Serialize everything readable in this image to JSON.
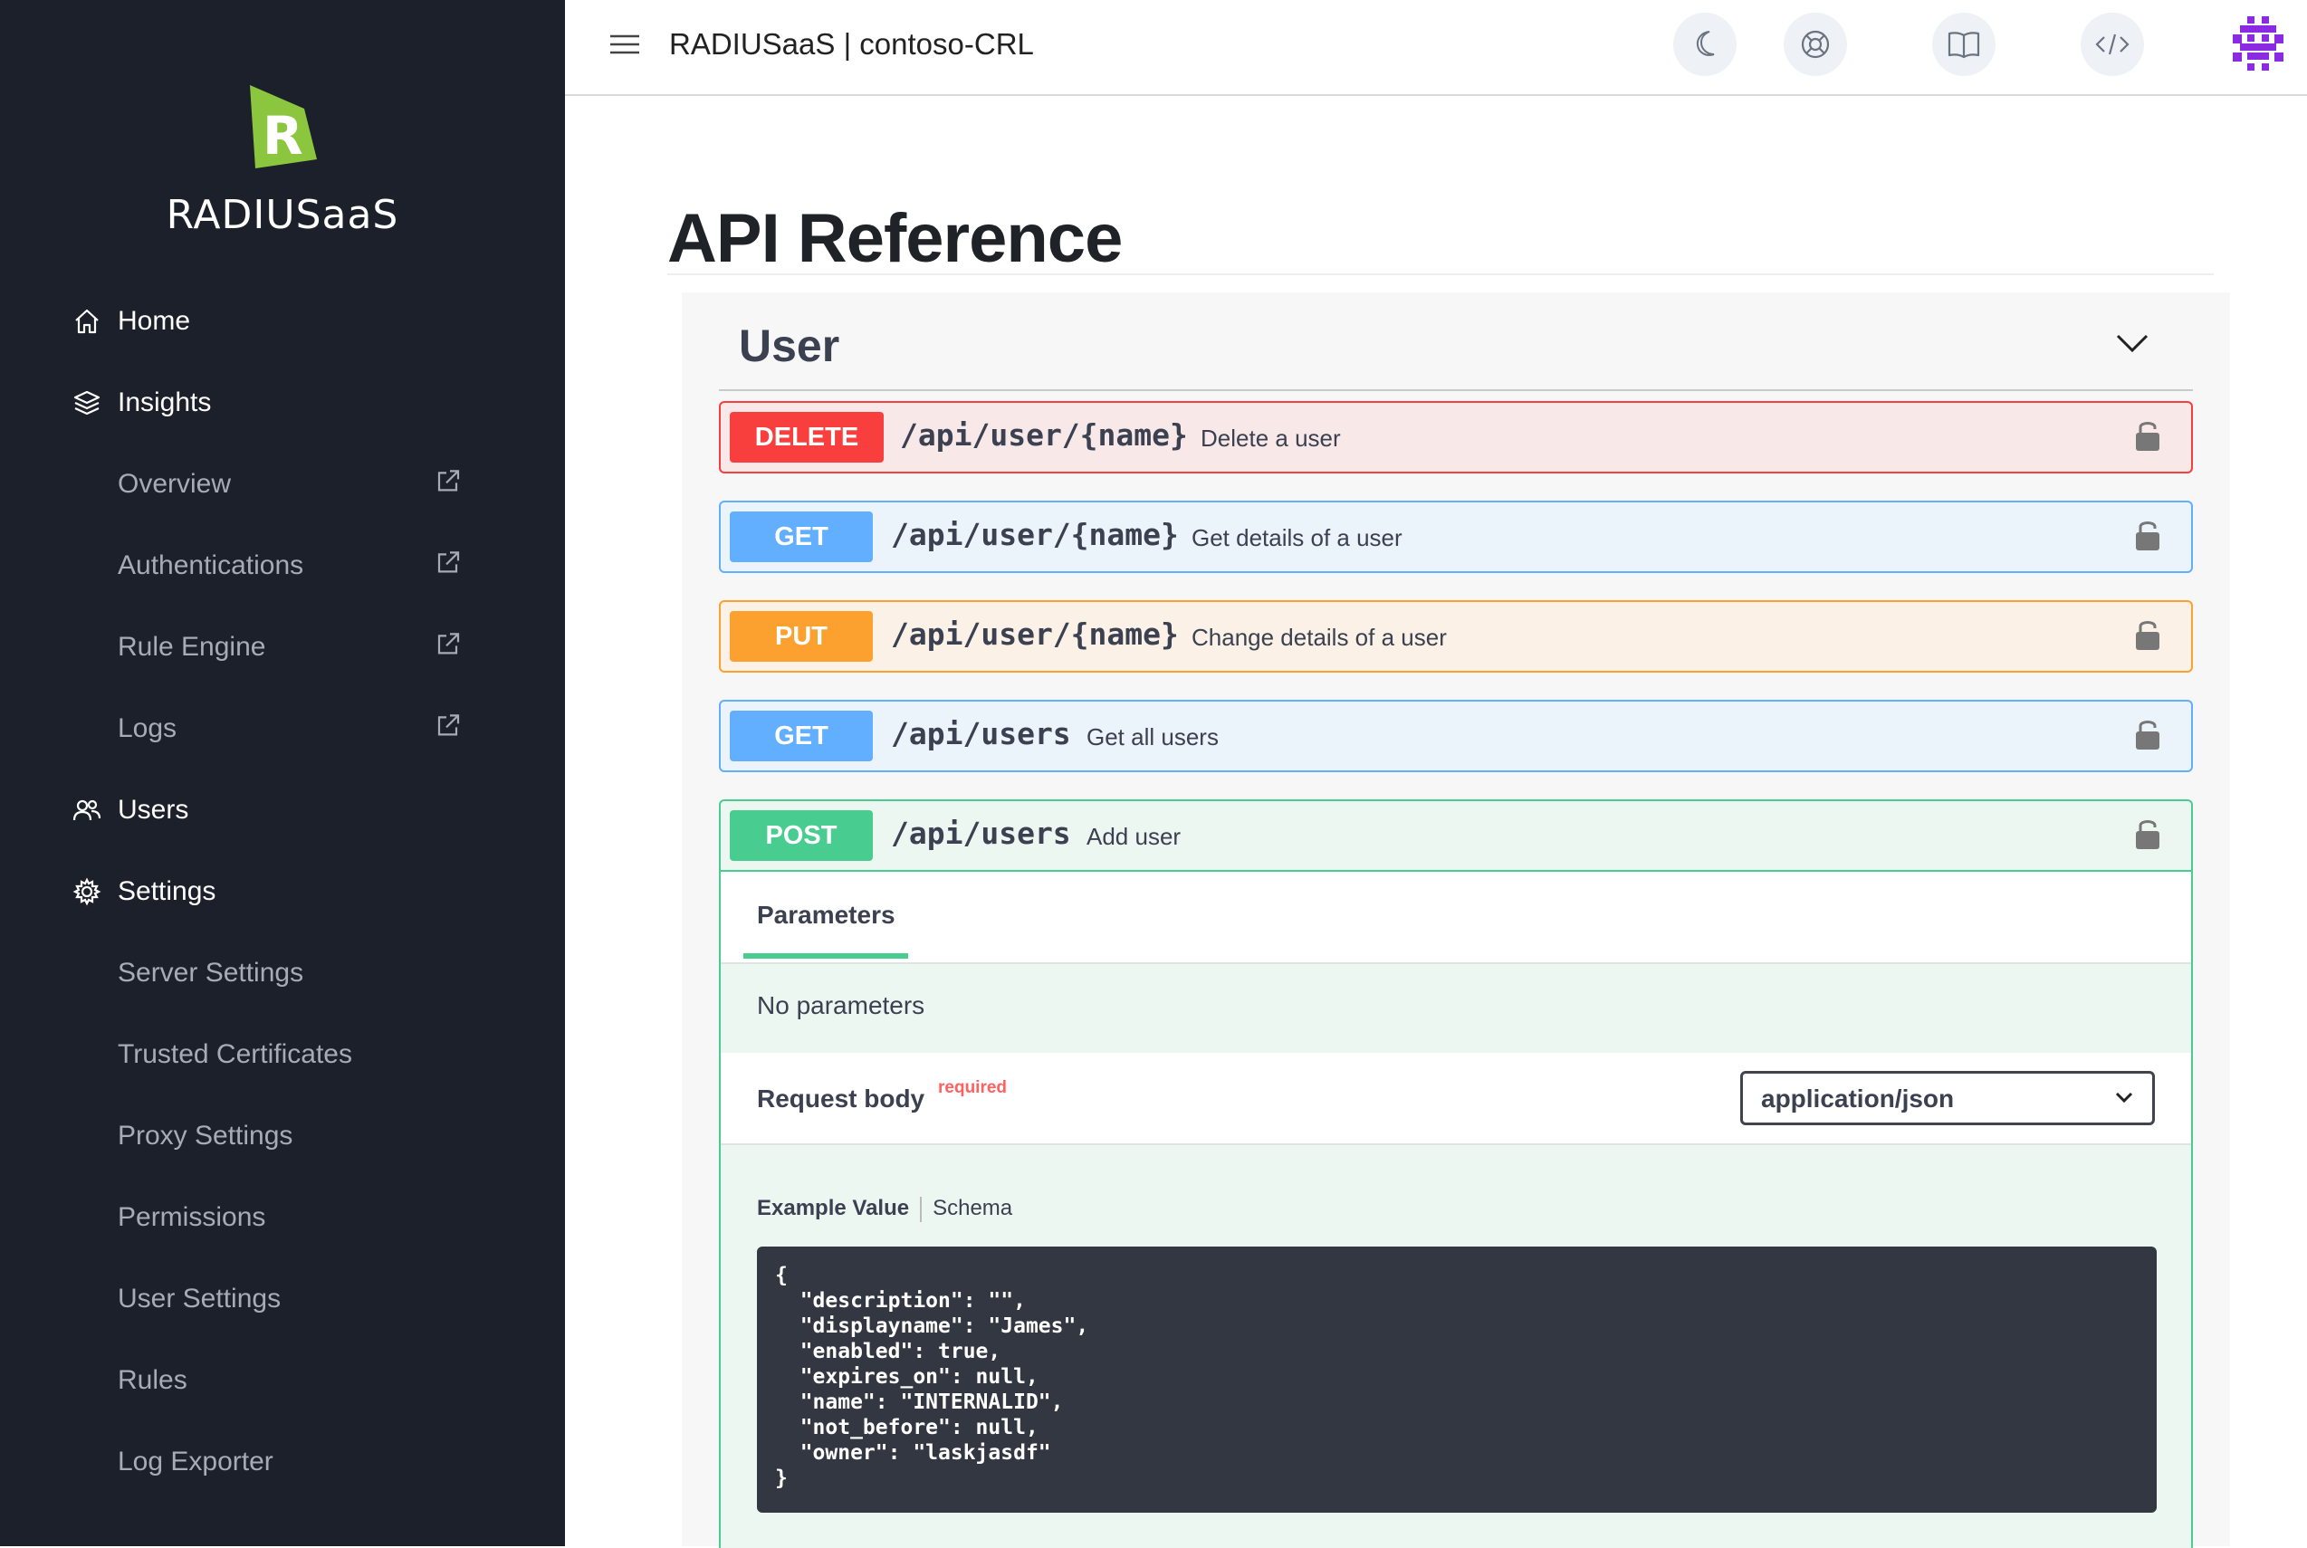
{
  "sidebar": {
    "brand_name": "RADIUSaaS",
    "logo_letter": "R",
    "items": [
      {
        "label": "Home",
        "icon": "home-icon",
        "level": "top",
        "external": false
      },
      {
        "label": "Insights",
        "icon": "layers-icon",
        "level": "top",
        "external": false
      },
      {
        "label": "Overview",
        "level": "sub",
        "external": true
      },
      {
        "label": "Authentications",
        "level": "sub",
        "external": true
      },
      {
        "label": "Rule Engine",
        "level": "sub",
        "external": true
      },
      {
        "label": "Logs",
        "level": "sub",
        "external": true
      },
      {
        "label": "Users",
        "icon": "users-icon",
        "level": "top",
        "external": false
      },
      {
        "label": "Settings",
        "icon": "gear-icon",
        "level": "top",
        "external": false
      },
      {
        "label": "Server Settings",
        "level": "sub",
        "external": false
      },
      {
        "label": "Trusted Certificates",
        "level": "sub",
        "external": false
      },
      {
        "label": "Proxy Settings",
        "level": "sub",
        "external": false
      },
      {
        "label": "Permissions",
        "level": "sub",
        "external": false
      },
      {
        "label": "User Settings",
        "level": "sub",
        "external": false
      },
      {
        "label": "Rules",
        "level": "sub",
        "external": false
      },
      {
        "label": "Log Exporter",
        "level": "sub",
        "external": false
      }
    ]
  },
  "header": {
    "title": "RADIUSaaS | contoso-CRL",
    "icons": [
      "menu-icon",
      "moon-icon",
      "lifebuoy-icon",
      "book-icon",
      "code-icon",
      "avatar"
    ]
  },
  "main": {
    "page_title": "API Reference",
    "section": {
      "title": "User",
      "operations": [
        {
          "method": "DELETE",
          "path": "/api/user/{name}",
          "summary": "Delete a user"
        },
        {
          "method": "GET",
          "path": "/api/user/{name}",
          "summary": "Get details of a user"
        },
        {
          "method": "PUT",
          "path": "/api/user/{name}",
          "summary": "Change details of a user"
        },
        {
          "method": "GET",
          "path": "/api/users",
          "summary": "Get all users"
        },
        {
          "method": "POST",
          "path": "/api/users",
          "summary": "Add user"
        }
      ],
      "expanded": {
        "parameters_tab": "Parameters",
        "no_parameters": "No parameters",
        "request_body_label": "Request body",
        "required_label": "required",
        "content_type": "application/json",
        "example_tab": "Example Value",
        "schema_tab": "Schema",
        "example_json": "{\n  \"description\": \"\",\n  \"displayname\": \"James\",\n  \"enabled\": true,\n  \"expires_on\": null,\n  \"name\": \"INTERNALID\",\n  \"not_before\": null,\n  \"owner\": \"laskjasdf\"\n}"
      }
    }
  },
  "colors": {
    "sidebar_bg": "#1c202b",
    "logo_green": "#8cc63f",
    "delete": "#f93e3e",
    "get": "#61affe",
    "put": "#fca130",
    "post": "#49cc90",
    "avatar_purple": "#8a2be2"
  }
}
